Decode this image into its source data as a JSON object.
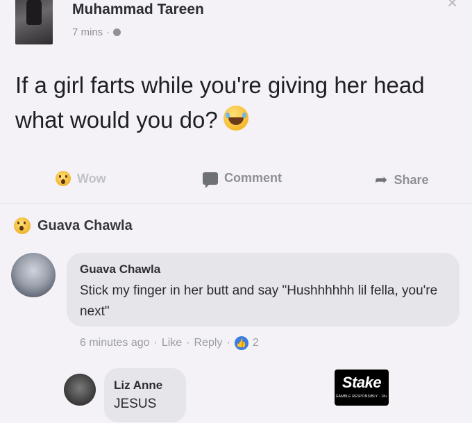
{
  "post": {
    "author": "Muhammad Tareen",
    "time": "7 mins",
    "separator": "·",
    "text": "If a girl farts while you're giving her head what would you do?"
  },
  "actions": {
    "wow": "Wow",
    "comment": "Comment",
    "share": "Share"
  },
  "reactors": {
    "name": "Guava Chawla"
  },
  "comments": [
    {
      "name": "Guava Chawla",
      "text": "Stick my finger in her butt and say \"Hushhhhhh lil fella, you're next\"",
      "time": "6 minutes ago",
      "like_label": "Like",
      "reply_label": "Reply",
      "like_count": "2"
    },
    {
      "name": "Liz Anne",
      "text": "JESUS"
    }
  ],
  "watermark": {
    "brand": "Stake",
    "tagline": "GAMBLE RESPONSIBLY · 18+"
  },
  "icons": {
    "post_reaction": "wow-emoji-icon",
    "comment": "comment-icon",
    "share": "share-arrow-icon",
    "privacy": "globe-icon",
    "post_emoji": "laughing-tears-emoji-icon",
    "like_badge": "thumbs-up-icon"
  },
  "colors": {
    "background": "#f4f2f7",
    "bubble": "#e6e5ea",
    "like_badge": "#3b7de0",
    "muted_text": "#8f9197"
  }
}
